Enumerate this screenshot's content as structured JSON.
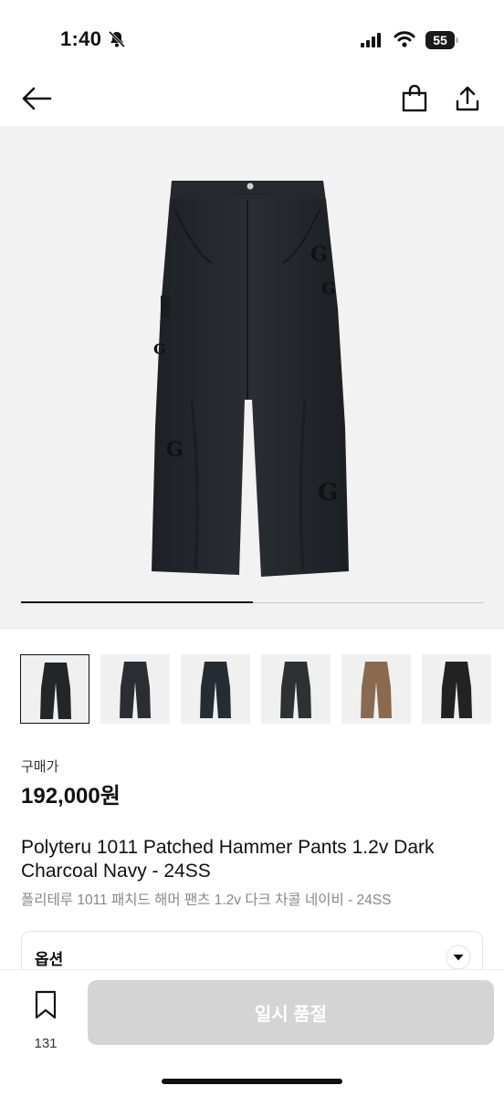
{
  "status": {
    "time": "1:40",
    "battery": "55"
  },
  "product": {
    "price_label": "구매가",
    "price": "192,000원",
    "title": "Polyteru 1011 Patched Hammer Pants 1.2v Dark Charcoal Navy - 24SS",
    "subtitle": "폴리테루 1011 패치드 해머 팬츠 1.2v 다크 차콜 네이비 - 24SS",
    "image_index_fraction": 0.5
  },
  "thumbnails": [
    {
      "color": "#232629",
      "active": true
    },
    {
      "color": "#2a2d31",
      "active": false
    },
    {
      "color": "#262c33",
      "active": false
    },
    {
      "color": "#2f3033",
      "active": false
    },
    {
      "color": "#8a6a4f",
      "active": false
    },
    {
      "color": "#222222",
      "active": false
    }
  ],
  "options": {
    "label": "옵션"
  },
  "bottom": {
    "wish_count": "131",
    "cta_label": "일시 품절"
  },
  "colors": {
    "hero_bg": "#f2f2f2",
    "cta_bg": "#d4d4d4"
  },
  "icons": [
    "bell-slash-icon",
    "signal-icon",
    "wifi-icon",
    "battery-icon",
    "back-arrow-icon",
    "shopping-bag-icon",
    "share-icon",
    "chevron-down-icon",
    "bookmark-icon"
  ]
}
